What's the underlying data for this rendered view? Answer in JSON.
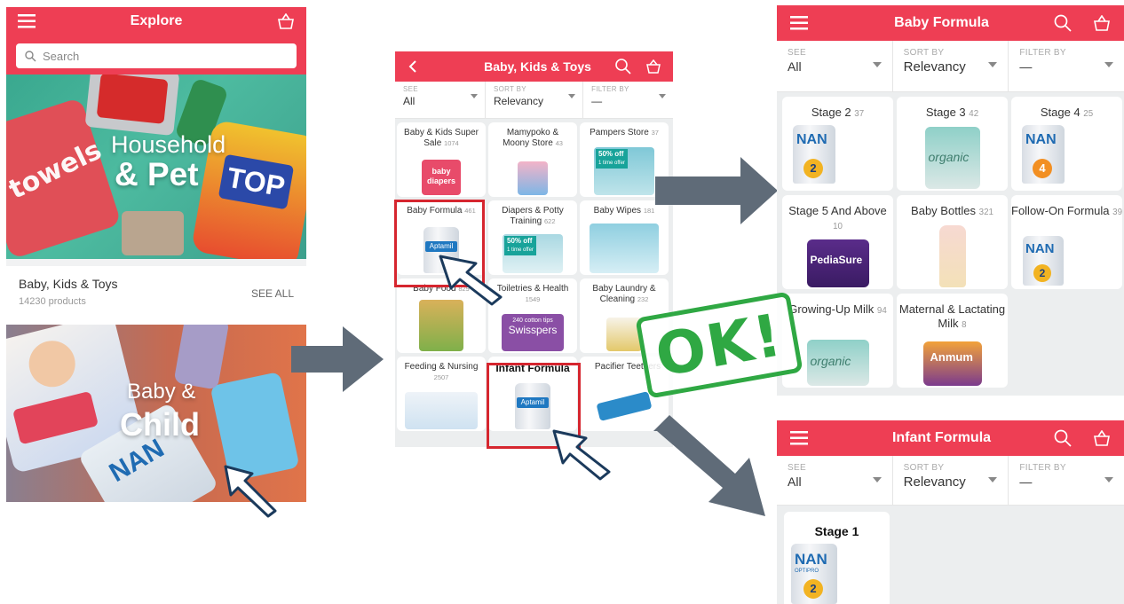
{
  "explore": {
    "title": "Explore",
    "search_placeholder": "Search",
    "banner1": {
      "line1": "Household",
      "line2": "& Pet"
    },
    "section": {
      "title": "Baby, Kids & Toys",
      "subtitle": "14230 products",
      "see_all": "SEE ALL"
    },
    "banner2": {
      "line1": "Baby &",
      "line2": "Child"
    }
  },
  "category": {
    "title": "Baby, Kids & Toys",
    "filters": {
      "see_label": "SEE",
      "see_value": "All",
      "sort_label": "SORT BY",
      "sort_value": "Relevancy",
      "filter_label": "FILTER BY",
      "filter_value": "—"
    },
    "items": [
      {
        "name": "Baby & Kids Super Sale",
        "count": "1074"
      },
      {
        "name": "Mamypoko & Moony Store",
        "count": "43"
      },
      {
        "name": "Pampers Store",
        "count": "37"
      },
      {
        "name": "Baby Formula",
        "count": "461"
      },
      {
        "name": "Diapers & Potty Training",
        "count": "622"
      },
      {
        "name": "Baby Wipes",
        "count": "181"
      },
      {
        "name": "Baby Food",
        "count": "829"
      },
      {
        "name": "Toiletries & Health",
        "count": "1549"
      },
      {
        "name": "Baby Laundry & Cleaning",
        "count": "232"
      },
      {
        "name": "Feeding & Nursing",
        "count": "2507"
      },
      {
        "name": "Infant Formula",
        "count": ""
      },
      {
        "name": "Pacifier Teethers",
        "count": ""
      }
    ],
    "badges": {
      "pampers_offer": "50% off",
      "pampers_offer_sub": "1 time offer",
      "diapers_offer": "50% off",
      "diapers_offer_sub": "1 time offer",
      "baby_diapers": "baby diapers",
      "aptamil": "Aptamil",
      "swisspers": "Swisspers",
      "swisspers_sub": "240 cotton tips"
    }
  },
  "baby_formula": {
    "title": "Baby Formula",
    "filters": {
      "see_label": "SEE",
      "see_value": "All",
      "sort_label": "SORT BY",
      "sort_value": "Relevancy",
      "filter_label": "FILTER BY",
      "filter_value": "—"
    },
    "items": [
      {
        "name": "Stage 2",
        "count": "37"
      },
      {
        "name": "Stage 3",
        "count": "42"
      },
      {
        "name": "Stage 4",
        "count": "25"
      },
      {
        "name": "Stage 5 And Above",
        "count": "10"
      },
      {
        "name": "Baby Bottles",
        "count": "321"
      },
      {
        "name": "Follow-On Formula",
        "count": "39"
      },
      {
        "name": "Growing-Up Milk",
        "count": "94"
      },
      {
        "name": "Maternal & Lactating Milk",
        "count": "8"
      }
    ],
    "labels": {
      "nan": "NAN",
      "optipro": "OPTIPRO",
      "organic": "organic",
      "pediasure": "PediaSure",
      "anmum": "Anmum"
    }
  },
  "ok_stamp": "OK!",
  "infant_formula": {
    "title": "Infant Formula",
    "filters": {
      "see_label": "SEE",
      "see_value": "All",
      "sort_label": "SORT BY",
      "sort_value": "Relevancy",
      "filter_label": "FILTER BY",
      "filter_value": "—"
    },
    "items": [
      {
        "name": "Stage 1",
        "count": ""
      }
    ],
    "labels": {
      "nan": "NAN",
      "optipro": "OPTIPRO"
    }
  },
  "colors": {
    "brand_red": "#ee3e54",
    "highlight_red": "#d6262f",
    "arrow_gray": "#5f6b78",
    "ok_green": "#2fa843"
  }
}
